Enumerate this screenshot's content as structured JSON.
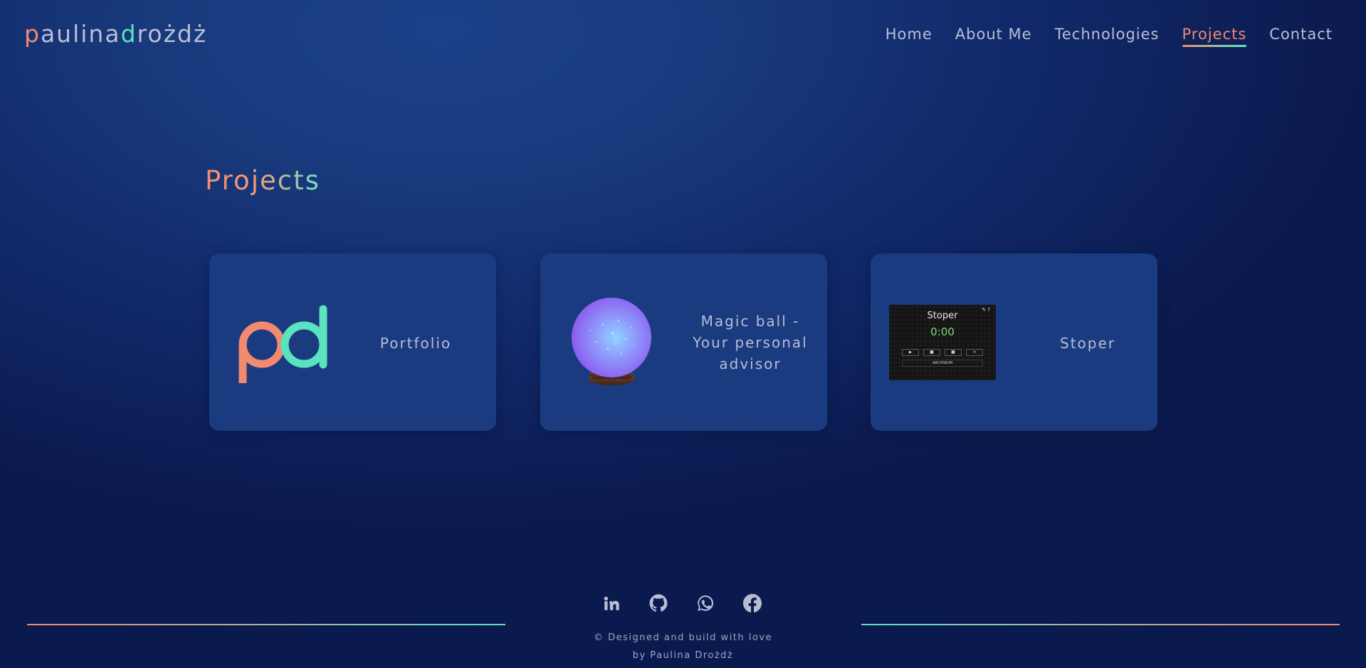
{
  "header": {
    "logo": {
      "first_initial": "p",
      "first_rest": "aulina",
      "last_initial": "d",
      "last_rest": "rożdż"
    },
    "nav": [
      {
        "label": "Home"
      },
      {
        "label": "About Me"
      },
      {
        "label": "Technologies"
      },
      {
        "label": "Projects",
        "active": true
      },
      {
        "label": "Contact"
      }
    ]
  },
  "main": {
    "title": "Projects",
    "cards": [
      {
        "label": "Portfolio",
        "image": "pd-logo"
      },
      {
        "label": "Magic ball - Your personal advisor",
        "image": "crystal-ball"
      },
      {
        "label": "Stoper",
        "image": "stoper-app-screenshot",
        "thumbnail": {
          "title": "Stoper",
          "time": "0:00",
          "archive": "ARCHIWUM"
        }
      }
    ]
  },
  "footer": {
    "socials": [
      {
        "icon": "linkedin-icon"
      },
      {
        "icon": "github-icon"
      },
      {
        "icon": "whatsapp-icon"
      },
      {
        "icon": "facebook-icon"
      }
    ],
    "copyright_line1": "© Designed and build with love",
    "copyright_line2": "by Paulina Drożdż"
  },
  "colors": {
    "accent_coral": "#f28a6f",
    "accent_mint": "#5ae3bd",
    "card_bg": "#1b3b80",
    "text": "#b9bfd6"
  }
}
